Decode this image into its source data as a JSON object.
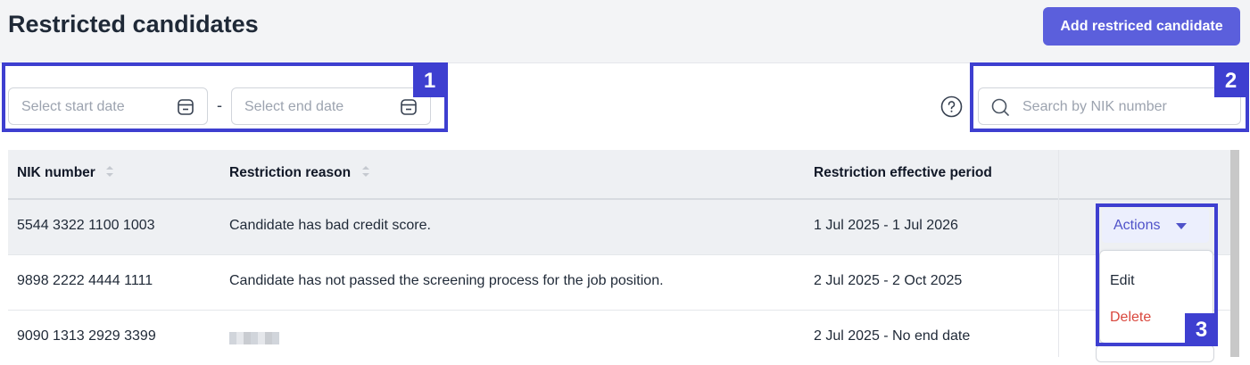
{
  "header": {
    "title": "Restricted candidates",
    "add_button_label": "Add restriced candidate"
  },
  "filters": {
    "start_date_placeholder": "Select start date",
    "end_date_placeholder": "Select end date",
    "separator": "-",
    "search_placeholder": "Search by NIK number"
  },
  "table": {
    "columns": [
      "NIK number",
      "Restriction reason",
      "Restriction effective period"
    ],
    "rows": [
      {
        "nik": "5544 3322 1100 1003",
        "reason": "Candidate has bad credit score.",
        "period": "1 Jul 2025 - 1 Jul 2026"
      },
      {
        "nik": "9898 2222 4444 1111",
        "reason": "Candidate has not passed the screening process for the job position.",
        "period": "2 Jul 2025 - 2 Oct 2025"
      },
      {
        "nik": "9090 1313 2929 3399",
        "reason": "",
        "period": "2 Jul 2025 - No end date"
      }
    ]
  },
  "actions": {
    "label": "Actions",
    "menu": [
      "Edit",
      "Delete"
    ]
  },
  "annotations": [
    "1",
    "2",
    "3"
  ],
  "colors": {
    "primary": "#5b5fdc",
    "annotation": "#3e3fd0",
    "danger": "#d9473d",
    "header_bg": "#f3f4f6"
  }
}
